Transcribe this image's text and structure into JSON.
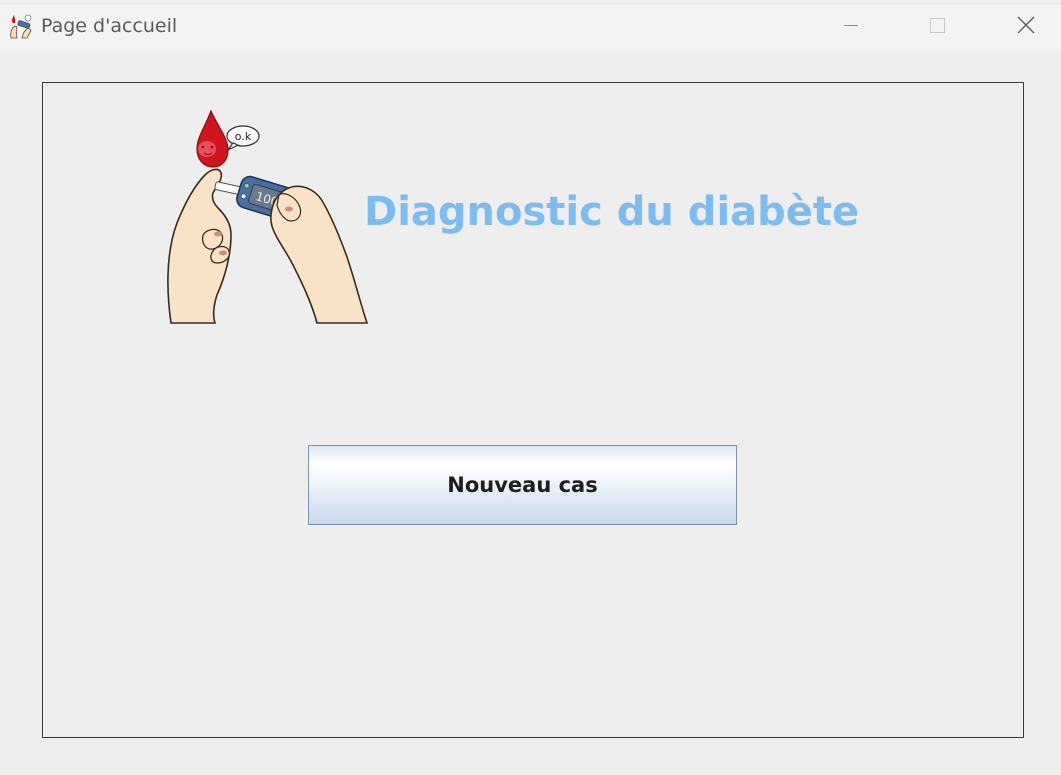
{
  "window": {
    "title": "Page d'accueil",
    "icon": "diabetes-test-icon",
    "controls": {
      "minimize_icon": "minimize-icon",
      "maximize_icon": "maximize-icon",
      "close_icon": "close-icon"
    }
  },
  "main": {
    "illustration": {
      "icon": "glucose-meter-illustration",
      "speech_bubble_text": "o.k",
      "meter_reading": "100mg/"
    },
    "heading": "Diagnostic du diabète",
    "new_case_label": "Nouveau cas"
  },
  "colors": {
    "heading": "#7cbcf0",
    "background": "#eeeeee",
    "blood_drop": "#d0161d",
    "meter_body": "#4a6fa5"
  }
}
